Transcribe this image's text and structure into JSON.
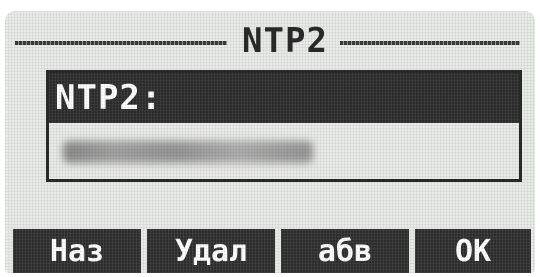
{
  "screen": {
    "title": "NTP2"
  },
  "field": {
    "label": "NTP2:",
    "value": ""
  },
  "softkeys": {
    "back": "Наз",
    "delete": "Удал",
    "input_mode": "абв",
    "ok": "OK"
  }
}
